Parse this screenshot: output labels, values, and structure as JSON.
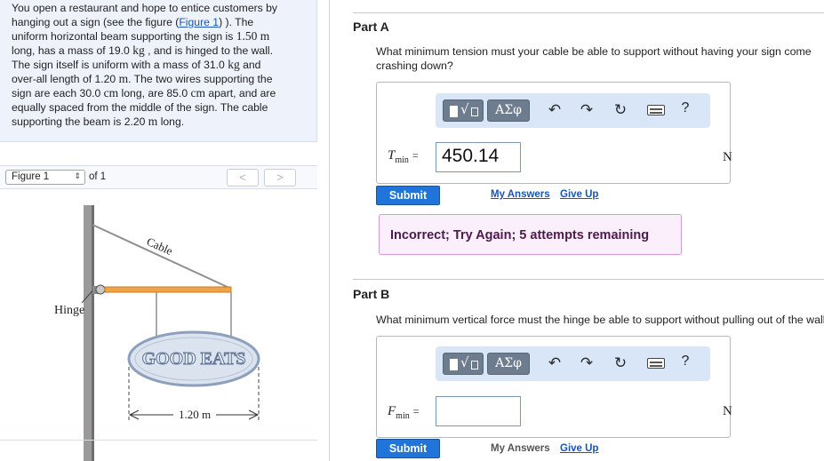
{
  "problem": {
    "lines": [
      "You open a restaurant and hope to entice customers by",
      "hanging out a sign (see the figure (",
      "uniform horizontal beam supporting the sign is ",
      "long, has a mass of 19.0 ",
      "The sign itself is uniform with a mass of 31.0 ",
      "over-all length of 1.20 ",
      "sign are each 30.0 ",
      "equally spaced from the middle of the sign. The cable",
      "supporting the beam is 2.20 "
    ],
    "figure_link": "Figure 1",
    "line2_tail": ") ). The",
    "len_beam": "1.50",
    "unit_m": "m",
    "unit_kg": "kg",
    "unit_cm": "cm",
    "line4_tail": ", and is hinged to the wall.",
    "line5_tail": " and",
    "line6_tail": ". The two wires supporting the",
    "line7_mid": " long, are 85.0 ",
    "line7_tail": " apart, and are",
    "line9_tail": " long."
  },
  "figure_nav": {
    "select_value": "Figure 1",
    "of_text": "of 1",
    "prev": "<",
    "next": ">"
  },
  "figure": {
    "cable_label": "Cable",
    "hinge_label": "Hinge",
    "sign_text": "GOOD EATS",
    "dimension_label": "1.20 m"
  },
  "partA": {
    "title": "Part A",
    "question": "What minimum tension must your cable be able to support without having your sign come crashing down?",
    "var": "T",
    "var_sub": "min",
    "eq": "=",
    "value": "450.14",
    "unit": "N",
    "submit": "Submit",
    "my_answers": "My Answers",
    "give_up": "Give Up",
    "feedback": "Incorrect; Try Again; 5 attempts remaining"
  },
  "partB": {
    "title": "Part B",
    "question": "What minimum vertical force must the hinge be able to support without pulling out of the wall?",
    "var": "F",
    "var_sub": "min",
    "eq": "=",
    "value": "",
    "unit": "N",
    "submit": "Submit",
    "my_answers": "My Answers",
    "give_up": "Give Up"
  },
  "toolbar": {
    "greek": "ΑΣφ",
    "undo": "↶",
    "redo": "↷",
    "reset": "↻",
    "help": "?",
    "icons": [
      "templates-icon",
      "greek-letters-icon",
      "undo-icon",
      "redo-icon",
      "reset-icon",
      "keyboard-icon",
      "help-icon"
    ]
  }
}
